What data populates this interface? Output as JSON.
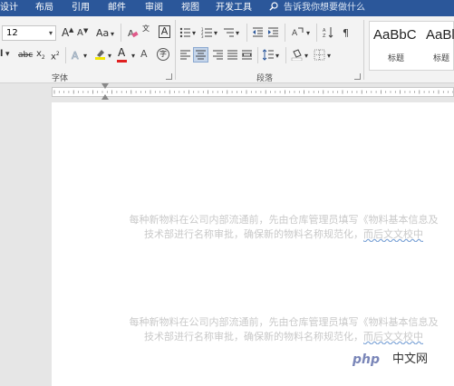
{
  "menu": {
    "tabs": [
      "设计",
      "布局",
      "引用",
      "邮件",
      "审阅",
      "视图",
      "开发工具"
    ],
    "search_placeholder": "告诉我你想要做什么"
  },
  "ribbon": {
    "font_size": "12",
    "grow_font": "A",
    "shrink_font": "A",
    "change_case": "Aa",
    "char_border": "A",
    "pinyin": "文",
    "strikethrough": "abc",
    "subscript": "x",
    "superscript": "x",
    "font_color_letter": "A",
    "enclose_char": "字",
    "group_font_label": "字体",
    "group_paragraph_label": "段落",
    "styles": [
      {
        "sample": "AaBbC",
        "name": "标题"
      },
      {
        "sample": "AaBl",
        "name": "标题"
      }
    ]
  },
  "document": {
    "paragraphs": [
      {
        "line1": "每种新物料在公司内部流通前，先由仓库管理员填写《物料基本信息及",
        "line2_prefix": "技术部进行名称审批，确保新的物料名称规范化，",
        "line2_squiggle": "而后文文校中"
      },
      {
        "line1": "每种新物料在公司内部流通前，先由仓库管理员填写《物料基本信息及",
        "line2_prefix": "技术部进行名称审批，确保新的物料名称规范化，",
        "line2_squiggle": "而后文文校中"
      }
    ]
  },
  "watermark": {
    "logo": "php",
    "text": "中文网"
  }
}
